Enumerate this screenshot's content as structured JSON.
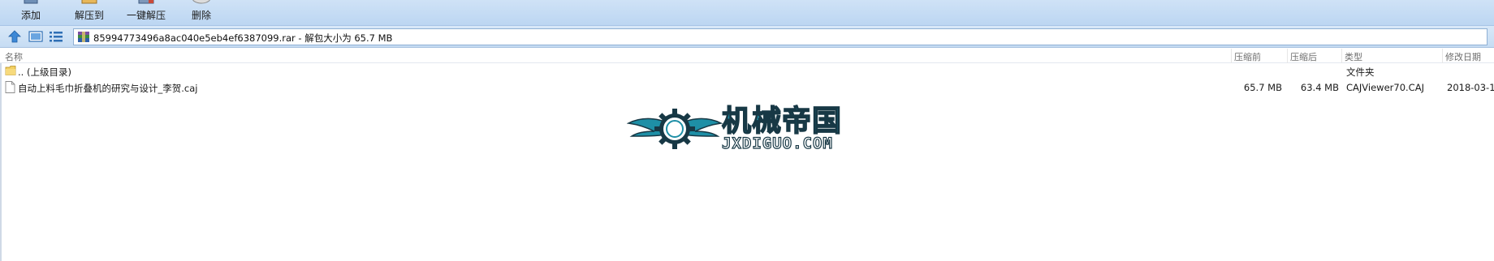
{
  "toolbar": {
    "add_label": "添加",
    "extract_to_label": "解压到",
    "one_click_extract_label": "一键解压",
    "delete_label": "删除"
  },
  "address": {
    "path": "85994773496a8ac040e5eb4ef6387099.rar - 解包大小为 65.7 MB"
  },
  "columns": {
    "name": "名称",
    "packed": "压缩前",
    "unpacked": "压缩后",
    "type": "类型",
    "modified": "修改日期"
  },
  "rows": [
    {
      "name": ".. (上级目录)",
      "packed": "",
      "unpacked": "",
      "type": "文件夹",
      "modified": "",
      "icon": "folder-icon"
    },
    {
      "name": "自动上料毛巾折叠机的研究与设计_李贺.caj",
      "packed": "65.7 MB",
      "unpacked": "63.4 MB",
      "type": "CAJViewer70.CAJ",
      "modified": "2018-03-1",
      "icon": "file-icon"
    }
  ],
  "watermark": {
    "title": "机械帝国",
    "subtitle": "JXDIGUO.COM"
  },
  "colors": {
    "toolbar_bg": "#c6dcf3",
    "watermark_teal": "#1e8fa6"
  }
}
